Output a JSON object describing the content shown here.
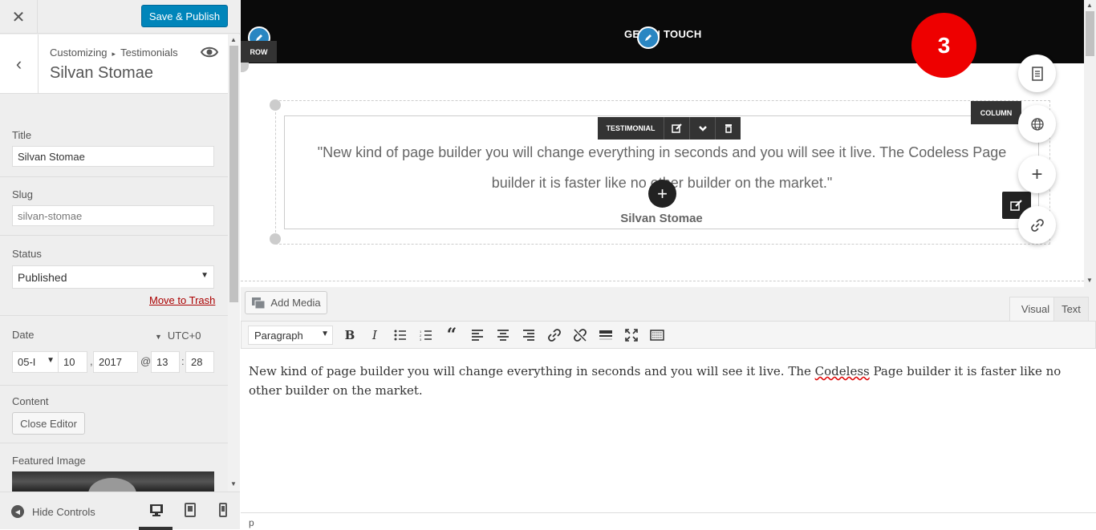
{
  "sidebar": {
    "close_label": "✕",
    "save_label": "Save & Publish",
    "breadcrumb_root": "Customizing",
    "breadcrumb_sep": "▸",
    "breadcrumb_section": "Testimonials",
    "heading": "Silvan Stomae",
    "fields": {
      "title_label": "Title",
      "title_value": "Silvan Stomae",
      "slug_label": "Slug",
      "slug_value": "silvan-stomae",
      "status_label": "Status",
      "status_value": "Published",
      "trash_link": "Move to Trash",
      "date_label": "Date",
      "timezone": "UTC+0",
      "date_month": "05-I",
      "date_day": "10",
      "date_year": "2017",
      "date_hour": "13",
      "date_minute": "28",
      "date_comma": ",",
      "date_at": "@",
      "date_colon": ":",
      "content_label": "Content",
      "close_editor_label": "Close Editor",
      "featured_label": "Featured Image"
    },
    "footer": {
      "hide_controls_label": "Hide Controls"
    }
  },
  "preview": {
    "banner_text": "GET IN TOUCH",
    "row_tag": "ROW",
    "column_tag": "COLUMN",
    "testimonial_tag": "TESTIMONIAL",
    "badge_number": "3",
    "quote": "\"New kind of page builder you will change everything in seconds and you will see it live. The Codeless Page builder it is faster like no other builder on the market.\"",
    "author": "Silvan Stomae"
  },
  "editor": {
    "add_media_label": "Add Media",
    "tab_visual": "Visual",
    "tab_text": "Text",
    "format_select": "Paragraph",
    "content_before": "New kind of page builder you will change everything in seconds and you will see it live. The ",
    "content_misspelled": "Codeless",
    "content_after": " Page builder it is faster like no other builder on the market.",
    "status_path": "p"
  },
  "colors": {
    "primary_button": "#0085ba",
    "badge": "#ee0000",
    "pen_circle": "#2a86c2",
    "link_danger": "#aa0000"
  }
}
